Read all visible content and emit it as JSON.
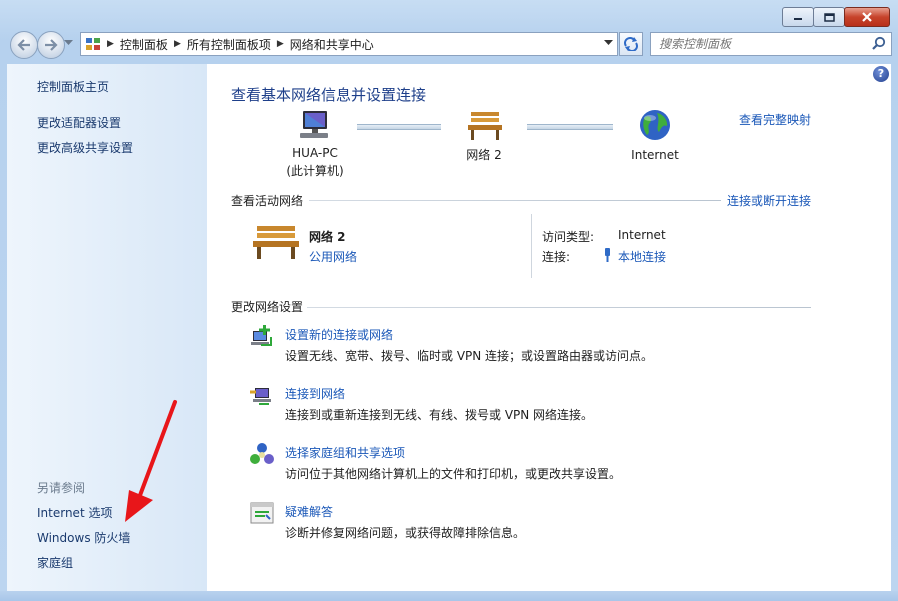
{
  "titlebar": {
    "buttons": [
      "minimize",
      "maximize",
      "close"
    ]
  },
  "navbar": {
    "breadcrumbs": [
      "控制面板",
      "所有控制面板项",
      "网络和共享中心"
    ],
    "search_placeholder": "搜索控制面板"
  },
  "sidebar": {
    "home": "控制面板主页",
    "links": [
      "更改适配器设置",
      "更改高级共享设置"
    ],
    "see_also_label": "另请参阅",
    "see_also": [
      "Internet 选项",
      "Windows 防火墙",
      "家庭组"
    ]
  },
  "main": {
    "title": "查看基本网络信息并设置连接",
    "full_map_link": "查看完整映射",
    "map": {
      "pc_name": "HUA-PC",
      "pc_sub": "(此计算机)",
      "network": "网络 2",
      "internet": "Internet"
    },
    "active": {
      "header": "查看活动网络",
      "connect_link": "连接或断开连接",
      "network_name": "网络 2",
      "network_type": "公用网络",
      "access_label": "访问类型:",
      "access_value": "Internet",
      "conn_label": "连接:",
      "conn_value": "本地连接"
    },
    "change": {
      "header": "更改网络设置",
      "tasks": [
        {
          "title": "设置新的连接或网络",
          "desc": "设置无线、宽带、拨号、临时或 VPN 连接；或设置路由器或访问点。"
        },
        {
          "title": "连接到网络",
          "desc": "连接到或重新连接到无线、有线、拨号或 VPN 网络连接。"
        },
        {
          "title": "选择家庭组和共享选项",
          "desc": "访问位于其他网络计算机上的文件和打印机，或更改共享设置。"
        },
        {
          "title": "疑难解答",
          "desc": "诊断并修复网络问题，或获得故障排除信息。"
        }
      ]
    }
  },
  "colors": {
    "link": "#1b58b8",
    "title": "#1e3f8a",
    "annotation_arrow": "#e8161a"
  }
}
